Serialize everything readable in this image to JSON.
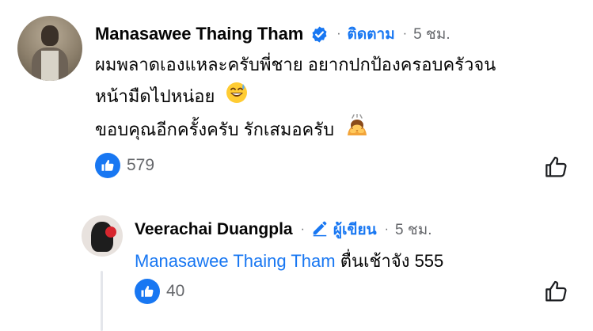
{
  "comment": {
    "author": "Manasawee Thaing Tham",
    "verified_icon": "verified-badge-icon",
    "separator": "·",
    "follow_label": "ติดตาม",
    "time": "5 ชม.",
    "lines": [
      "ผมพลาดเองแหละครับพี่ชาย อยากปกป้องครอบครัวจน",
      "หน้ามืดไปหน่อย",
      "ขอบคุณอีกครั้งครับ รักเสมอครับ"
    ],
    "emoji_1": "sweat-smile-emoji",
    "emoji_2": "bowing-person-emoji",
    "like_count": "579"
  },
  "reply": {
    "author": "Veerachai Duangpla",
    "author_badge_icon": "pencil-icon",
    "author_badge_label": "ผู้เขียน",
    "separator": "·",
    "time": "5 ชม.",
    "mention": "Manasawee Thaing Tham",
    "text": "ตื่นเช้าจัง 555",
    "like_count": "40"
  },
  "colors": {
    "accent": "#1877f2",
    "secondary_text": "#65676b",
    "primary_text": "#050505",
    "thread_line": "#e4e6eb"
  }
}
